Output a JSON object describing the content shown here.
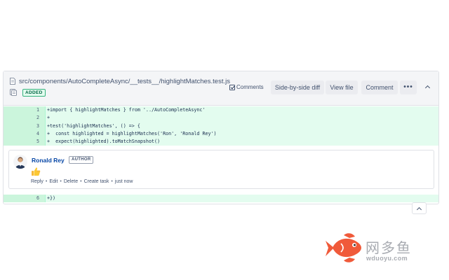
{
  "file": {
    "path": "src/components/AutoCompleteAsync/__tests__/highlightMatches.test.js",
    "status_badge": "ADDED"
  },
  "toolbar": {
    "comments_label": "Comments",
    "comments_checked": true,
    "side_by_side_label": "Side-by-side diff",
    "view_file_label": "View file",
    "comment_label": "Comment",
    "more_label": "•••"
  },
  "diff_lines": [
    {
      "number": "1",
      "code": "+import { highlightMatches } from '../AutoCompleteAsync'"
    },
    {
      "number": "2",
      "code": "+"
    },
    {
      "number": "3",
      "code": "+test('highlightMatches', () => {"
    },
    {
      "number": "4",
      "code": "+  const highlighted = highlightMatches('Ron', 'Ronald Rey')"
    },
    {
      "number": "5",
      "code": "+  expect(highlighted).toMatchSnapshot()"
    },
    {
      "number": "6",
      "code": "+})"
    }
  ],
  "comment": {
    "author": "Ronald Rey",
    "author_badge": "AUTHOR",
    "body_icon": "thumbs-up-icon",
    "actions": {
      "reply": "Reply",
      "edit": "Edit",
      "delete": "Delete",
      "create_task": "Create task",
      "time": "just now"
    }
  },
  "watermark": {
    "title": "网多鱼",
    "url": "wduoyu.com"
  },
  "colors": {
    "added_bg": "#e3fcef",
    "added_gutter": "#cbf5dc",
    "link": "#0747a6",
    "header_bg": "#f4f5f7",
    "logo_red": "#f05a3a"
  }
}
